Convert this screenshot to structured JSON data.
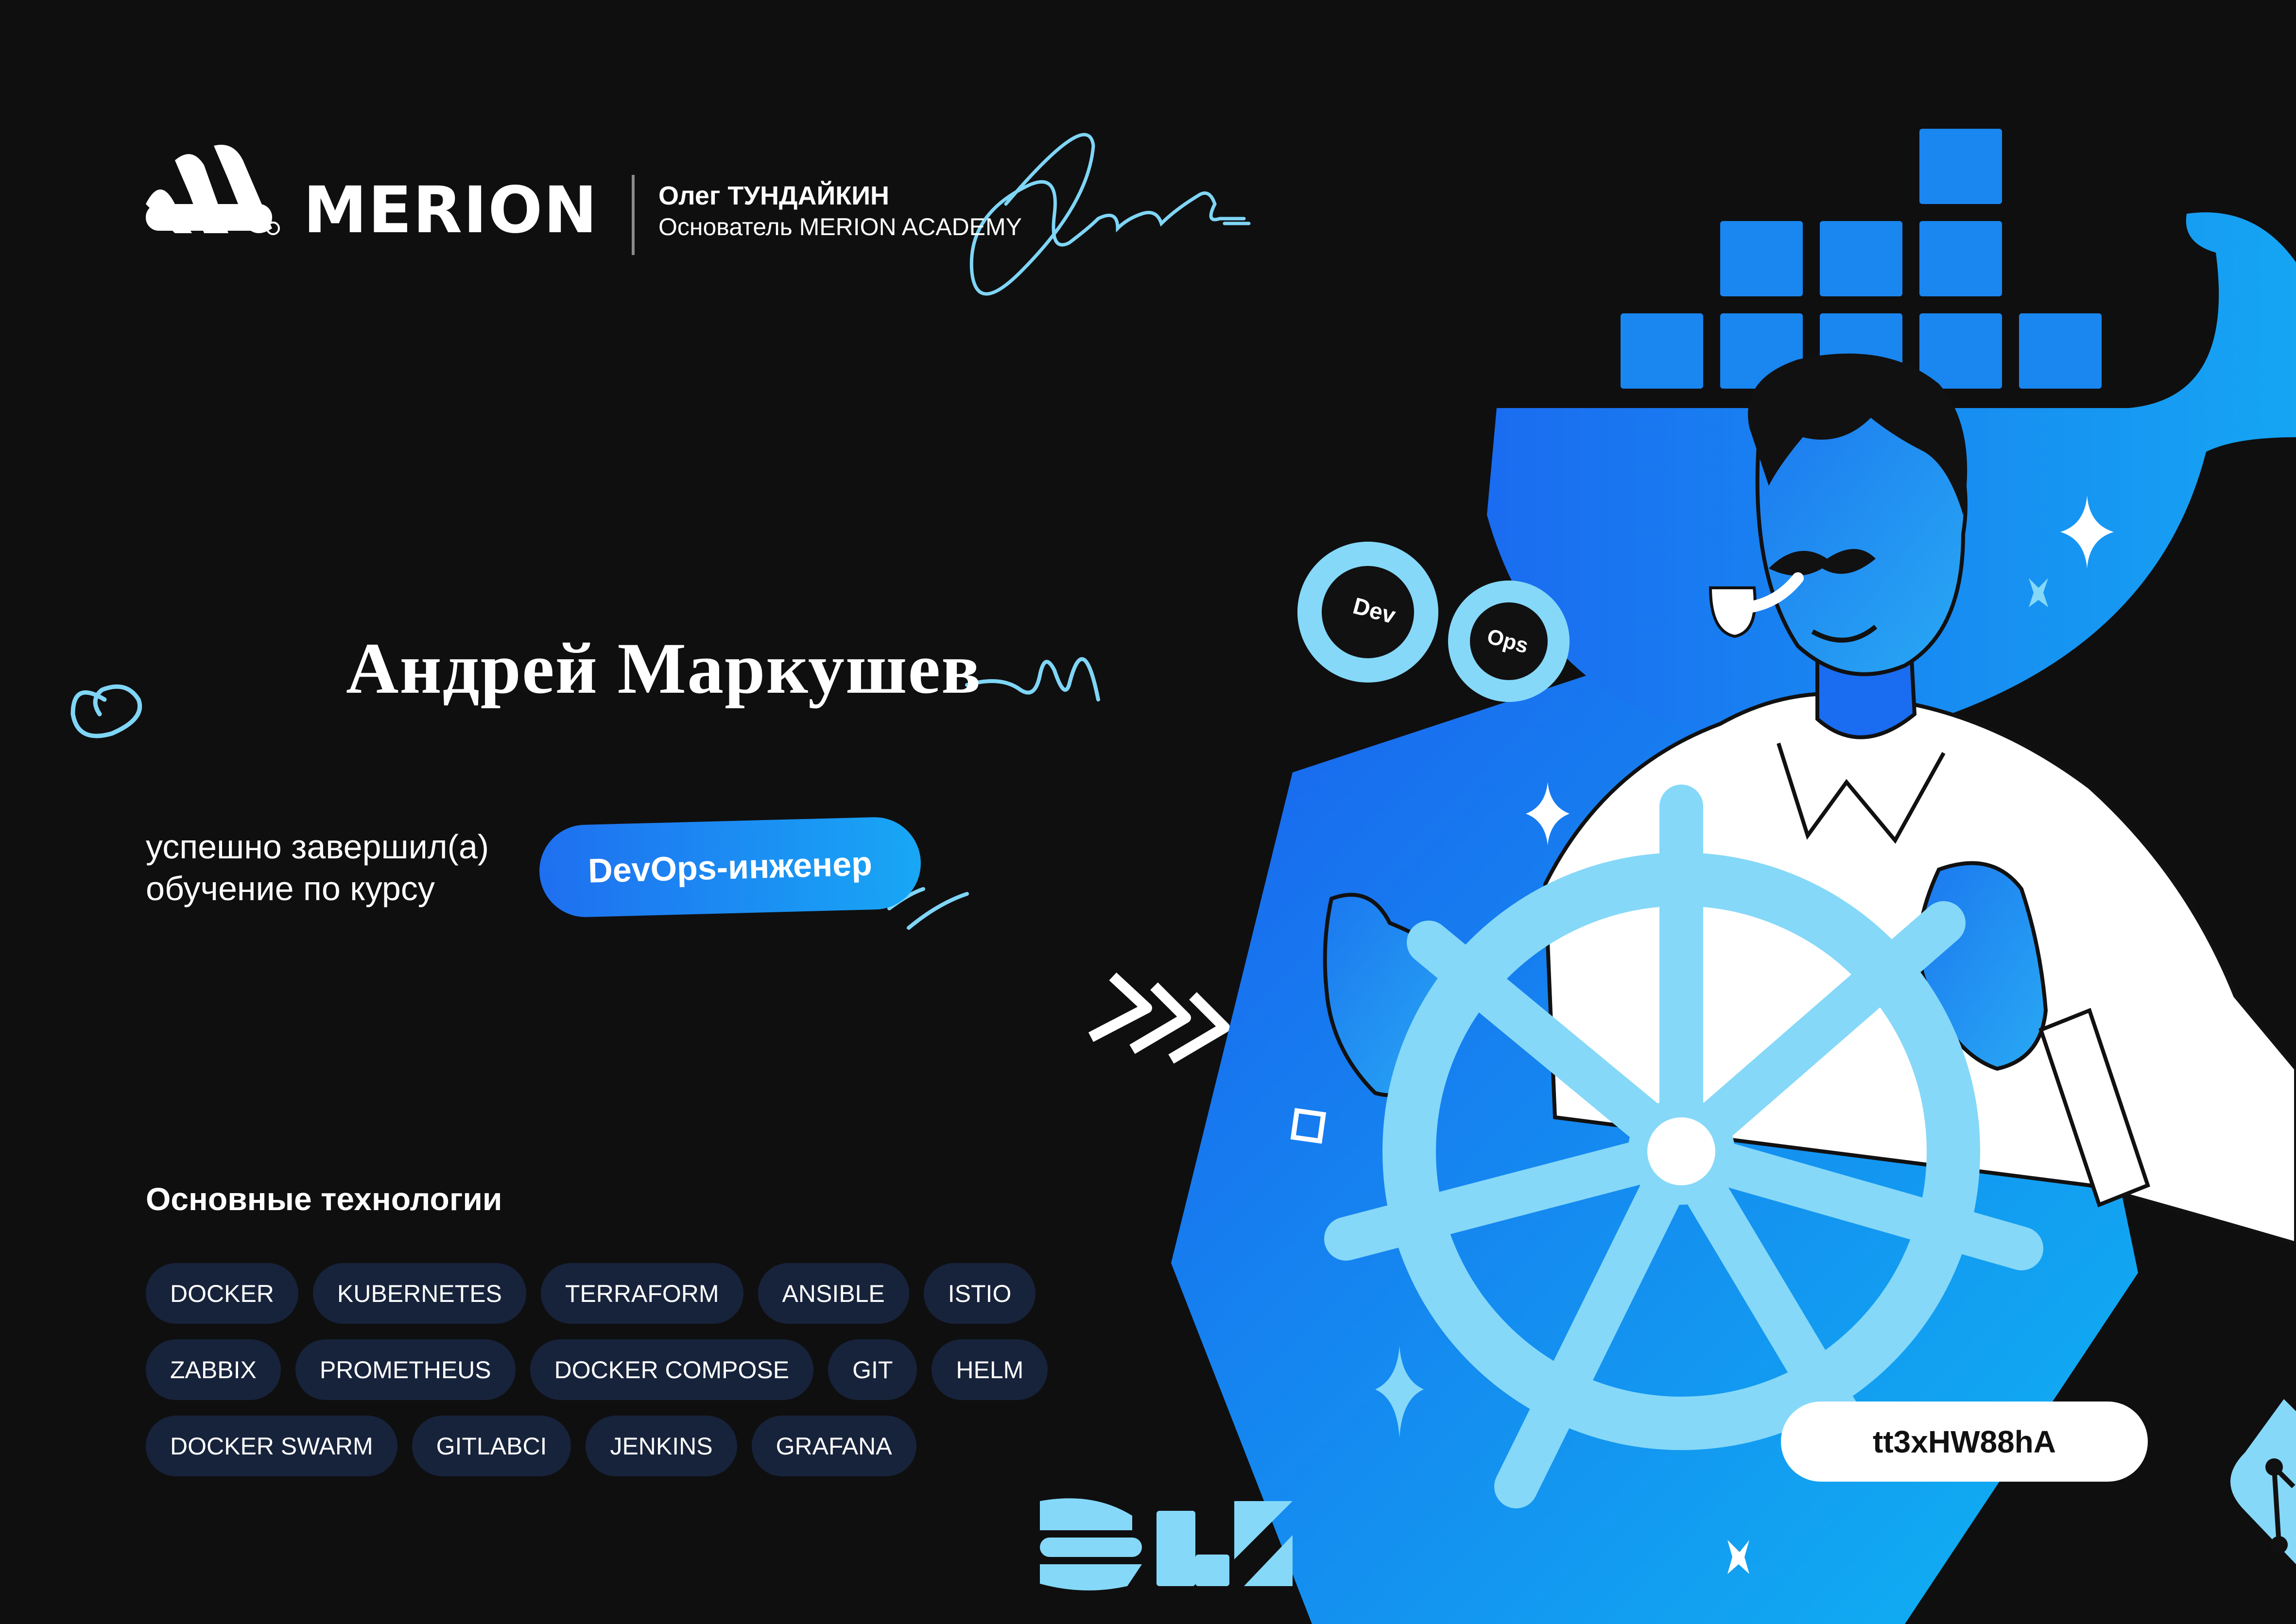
{
  "brand": {
    "name": "MERION"
  },
  "founder": {
    "name": "Олег ТУНДАЙКИН",
    "role": "Основатель MERION ACADEMY"
  },
  "student": {
    "name": "Андрей Маркушев"
  },
  "completion": {
    "line1": "успешно завершил(а)",
    "line2": "обучение по курсу"
  },
  "course": {
    "name": "DevOps-инженер"
  },
  "technologies": {
    "title": "Основные технологии",
    "rows": [
      [
        "DOCKER",
        "KUBERNETES",
        "TERRAFORM",
        "ANSIBLE",
        "ISTIO"
      ],
      [
        "ZABBIX",
        "PROMETHEUS",
        "DOCKER COMPOSE",
        "GIT",
        "HELM"
      ],
      [
        "DOCKER SWARM",
        "GITLABCI",
        "JENKINS",
        "GRAFANA"
      ]
    ]
  },
  "illustration": {
    "devops_badge": {
      "dev": "Dev",
      "ops": "Ops"
    },
    "icons": [
      "merion-logo-icon",
      "signature",
      "docker-whale-icon",
      "kubernetes-helm-wheel-icon",
      "devops-infinity-icon",
      "elk-logo-icon",
      "git-logo-icon"
    ]
  },
  "certificate": {
    "code": "tt3xHW88hA"
  },
  "colors": {
    "background": "#0f0f10",
    "accent_blue": "#1f6ff0",
    "accent_cyan": "#18a7f5",
    "light_blue": "#85d8f8",
    "tag_bg": "#17233b"
  }
}
